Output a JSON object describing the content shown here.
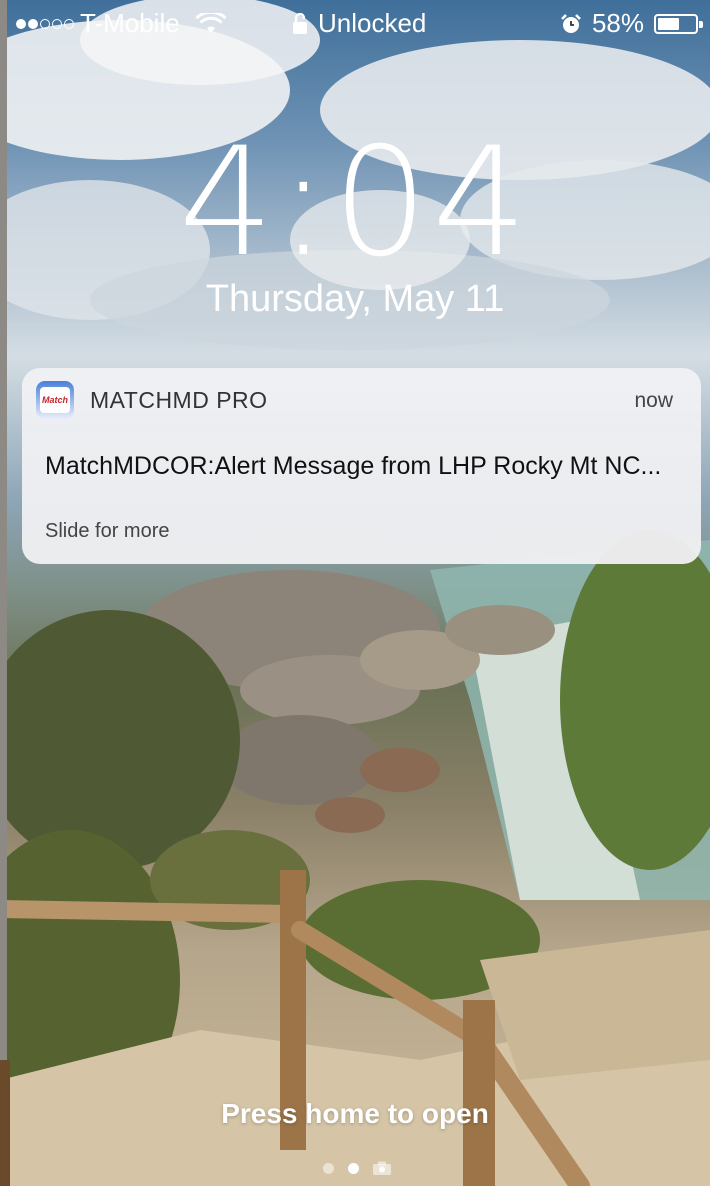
{
  "status_bar": {
    "signal_strength": 2,
    "carrier": "T-Mobile",
    "lock_status": "Unlocked",
    "battery_percent": "58%",
    "battery_level": 0.58
  },
  "lock_screen": {
    "time": "4:04",
    "date": "Thursday, May 11"
  },
  "notification": {
    "app_name": "MATCHMD PRO",
    "timestamp": "now",
    "message": "MatchMDCOR:Alert Message from LHP Rocky Mt NC...",
    "hint": "Slide for more",
    "icon_name": "matchmd-app-icon"
  },
  "footer": {
    "instruction": "Press home to open",
    "pages": [
      "today-view",
      "lock-screen",
      "camera"
    ],
    "active_page": 1
  },
  "colors": {
    "text": "#ffffff",
    "notification_bg": "#f2f2f4"
  }
}
